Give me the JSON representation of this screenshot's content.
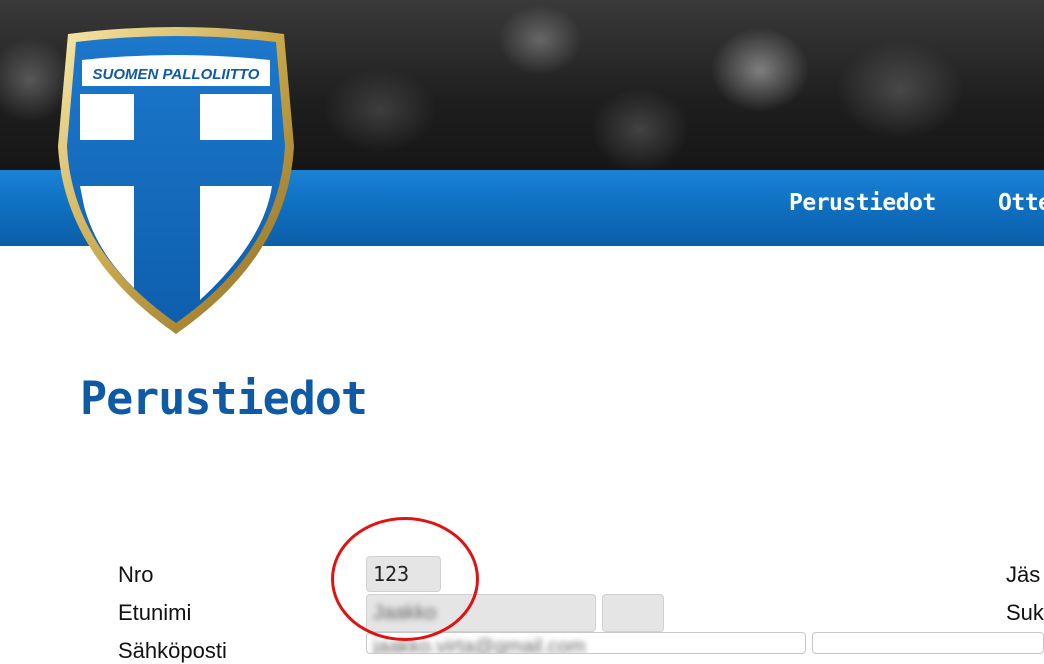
{
  "logo": {
    "text": "SUOMEN PALLOLIITTO",
    "colors": {
      "shield_blue": "#1466b8",
      "gold_border": "#c9a64a"
    }
  },
  "nav": {
    "items": [
      {
        "label": "Perustiedot"
      },
      {
        "label": "Otte"
      }
    ]
  },
  "page": {
    "title": "Perustiedot"
  },
  "form": {
    "labels": {
      "nro": "Nro",
      "etunimi": "Etunimi",
      "sahkoposti": "Sähköposti",
      "right_top": "Jäs",
      "right_second": "Suk"
    },
    "values": {
      "nro": "123",
      "etunimi": "Jaakko",
      "sahkoposti": "jaakko.virta@gmail.com"
    }
  },
  "theme": {
    "nav_blue": "#0e6dbd",
    "title_blue": "#0f5aa6",
    "annotation_red": "#e01313"
  }
}
